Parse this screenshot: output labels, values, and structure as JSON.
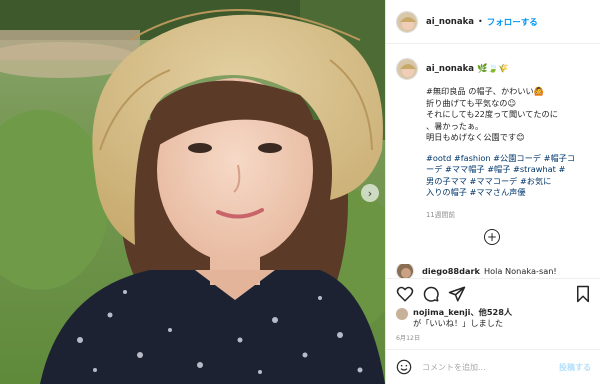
{
  "header": {
    "username": "ai_nonaka",
    "separator": "•",
    "follow_label": "フォローする"
  },
  "caption": {
    "username": "ai_nonaka",
    "emoji": "🌿🍃🌾",
    "lines": [
      "#無印良品 の帽子、かわいい🙆",
      "折り曲げても平気なの☺",
      "それにしても22度って聞いてたのに",
      "、暑かったぁ。",
      "明日もめげなく公園です😊"
    ],
    "tags_lines": [
      "#ootd #fashion #公園コーデ #帽子コ",
      "ーデ #ママ帽子 #帽子 #strawhat #",
      "男の子ママ #ママコーデ #お気に",
      "入りの帽子 #ママさん声優"
    ],
    "time": "11週間前"
  },
  "comment_peek": {
    "username": "diego88dark",
    "text": "Hola Nonaka-san!"
  },
  "likes": {
    "line1_user": "nojima_kenji",
    "line1_rest": "、他528人",
    "line2": "が「いいね！」しました"
  },
  "date": "6月12日",
  "comment_box": {
    "placeholder": "コメントを追加...",
    "post_label": "投稿する"
  },
  "carousel_arrow": "›",
  "plus_label": "+",
  "icons": [
    "heart-icon",
    "comment-icon",
    "share-icon",
    "bookmark-icon",
    "smile-icon"
  ]
}
